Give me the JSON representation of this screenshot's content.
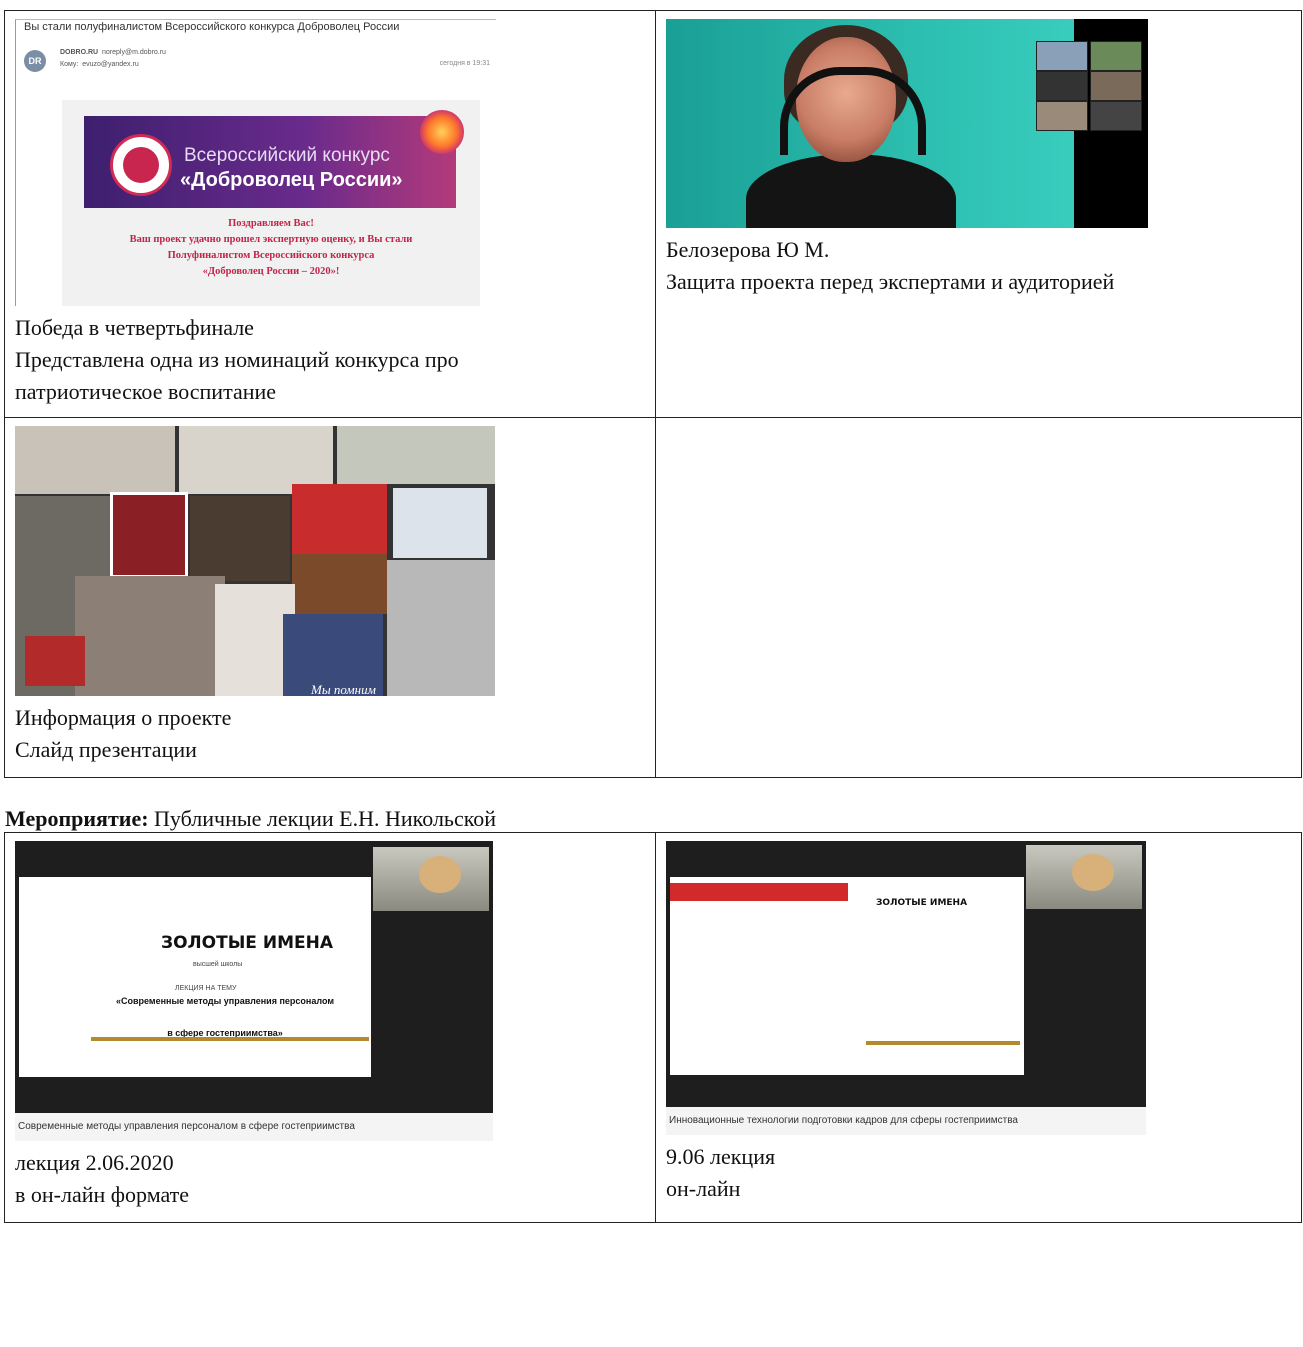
{
  "table1": {
    "cell_1_1": {
      "email": {
        "subject": "Вы стали полуфиналистом Всероссийского конкурса Доброволец России",
        "avatar": "DR",
        "from_name": "DOBRO.RU",
        "from_addr": "noreply@m.dobro.ru",
        "to_label": "Кому:",
        "to_addr": "evuzo@yandex.ru",
        "time": "сегодня в 19:31",
        "banner_line1": "Всероссийский конкурс",
        "banner_line2": "«Доброволец России»",
        "msg1": "Поздравляем Вас!",
        "msg2": "Ваш проект удачно прошел экспертную оценку, и Вы стали",
        "msg3": "Полуфиналистом Всероссийского конкурса",
        "msg4": "«Доброволец России – 2020»!"
      },
      "caption": [
        "Победа в четвертьфинале",
        "Представлена одна из номинаций конкурса про",
        "патриотическое воспитание"
      ]
    },
    "cell_1_2": {
      "caption": [
        "Белозерова Ю М.",
        "Защита проекта перед экспертами и аудиторией"
      ]
    },
    "cell_2_1": {
      "collage_text": "Мы помним",
      "caption": [
        "Информация о проекте",
        "Слайд презентации"
      ]
    },
    "cell_2_2": {
      "caption": []
    }
  },
  "section": {
    "label": "Мероприятие:",
    "value": " Публичные лекции Е.Н. Никольской"
  },
  "table2": {
    "cell_1_1": {
      "screen": {
        "logo": "ЗОЛОТЫЕ ИМЕНА",
        "logo_sub": "высшей школы",
        "topic_label": "ЛЕКЦИЯ НА ТЕМУ",
        "topic1": "«Современные методы управления персоналом",
        "topic2": "в сфере гостеприимства»",
        "footer": "Современные методы управления персоналом в сфере гостеприимства"
      },
      "caption": [
        "лекция 2.06.2020",
        "в он-лайн формате"
      ]
    },
    "cell_1_2": {
      "screen": {
        "logo": "ЗОЛОТЫЕ ИМЕНА",
        "footer": "Инновационные технологии подготовки кадров для сферы гостеприимства"
      },
      "caption": [
        "9.06 лекция",
        "он-лайн"
      ]
    }
  }
}
